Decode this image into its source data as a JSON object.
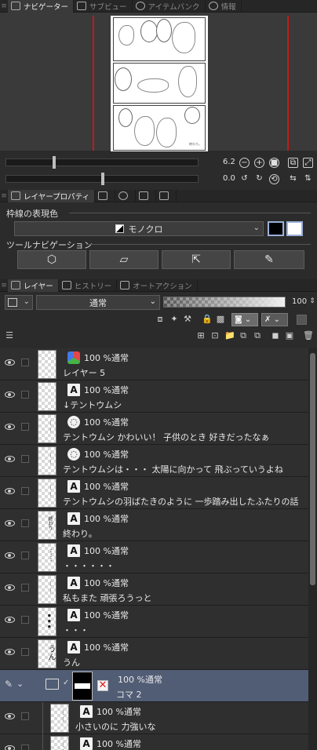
{
  "top_tabs": [
    {
      "label": "ナビゲーター",
      "active": true,
      "icon": "navigator-icon"
    },
    {
      "label": "サブビュー",
      "active": false,
      "icon": "subview-icon"
    },
    {
      "label": "アイテムバンク",
      "active": false,
      "icon": "item-bank-icon"
    },
    {
      "label": "情報",
      "active": false,
      "icon": "info-icon"
    }
  ],
  "navigator": {
    "zoom": "6.2",
    "rotation": "0.0",
    "page_texts": [
      "終わり。"
    ]
  },
  "prop_tabs": [
    {
      "label": "レイヤープロパティ",
      "active": true,
      "icon": "layer-property-icon"
    }
  ],
  "layer_property": {
    "border_color_title": "枠線の表現色",
    "border_color_value": "モノクロ",
    "color_swatches": [
      "#000000",
      "#ffffff"
    ],
    "tool_nav_title": "ツールナビゲーション",
    "tool_nav_icons": [
      "cube-select-icon",
      "layer-warp-icon",
      "select-arrow-icon",
      "pen-icon"
    ]
  },
  "layer_tabs": [
    {
      "label": "レイヤー",
      "active": true,
      "icon": "layers-icon"
    },
    {
      "label": "ヒストリー",
      "active": false,
      "icon": "history-icon"
    },
    {
      "label": "オートアクション",
      "active": false,
      "icon": "auto-action-icon"
    }
  ],
  "layer_toolbar": {
    "blend_mode": "通常",
    "opacity": "100",
    "opacity_fraction": 1.0
  },
  "layers": [
    {
      "mode": "100 %通常",
      "name": "レイヤー 5",
      "type": "color"
    },
    {
      "mode": "100 %通常",
      "name": "↓テントウムシ",
      "type": "text"
    },
    {
      "mode": "100 %通常",
      "name": "テントウムシ かわいい！ 子供のとき 好きだったなぁ",
      "type": "balloon"
    },
    {
      "mode": "100 %通常",
      "name": "テントウムシは・・・ 太陽に向かって 飛ぶっていうよね",
      "type": "balloon"
    },
    {
      "mode": "100 %通常",
      "name": "テントウムシの羽ばたきのように 一歩踏み出したふたりの話",
      "type": "text"
    },
    {
      "mode": "100 %通常",
      "name": "終わり。",
      "type": "text",
      "thumb": "終わり"
    },
    {
      "mode": "100 %通常",
      "name": "・・・・・・",
      "type": "text"
    },
    {
      "mode": "100 %通常",
      "name": "私もまた 頑張ろうっと",
      "type": "text"
    },
    {
      "mode": "100 %通常",
      "name": "・・・",
      "type": "text"
    },
    {
      "mode": "100 %通常",
      "name": "うん",
      "type": "text",
      "thumb": "うん"
    },
    {
      "mode": "100 %通常",
      "name": "コマ 2",
      "type": "frame-folder",
      "selected": true
    },
    {
      "mode": "100 %通常",
      "name": "小さいのに 力強いな",
      "type": "text",
      "indent": true
    },
    {
      "mode": "100 %通常",
      "name": "",
      "type": "text",
      "indent": true
    }
  ]
}
